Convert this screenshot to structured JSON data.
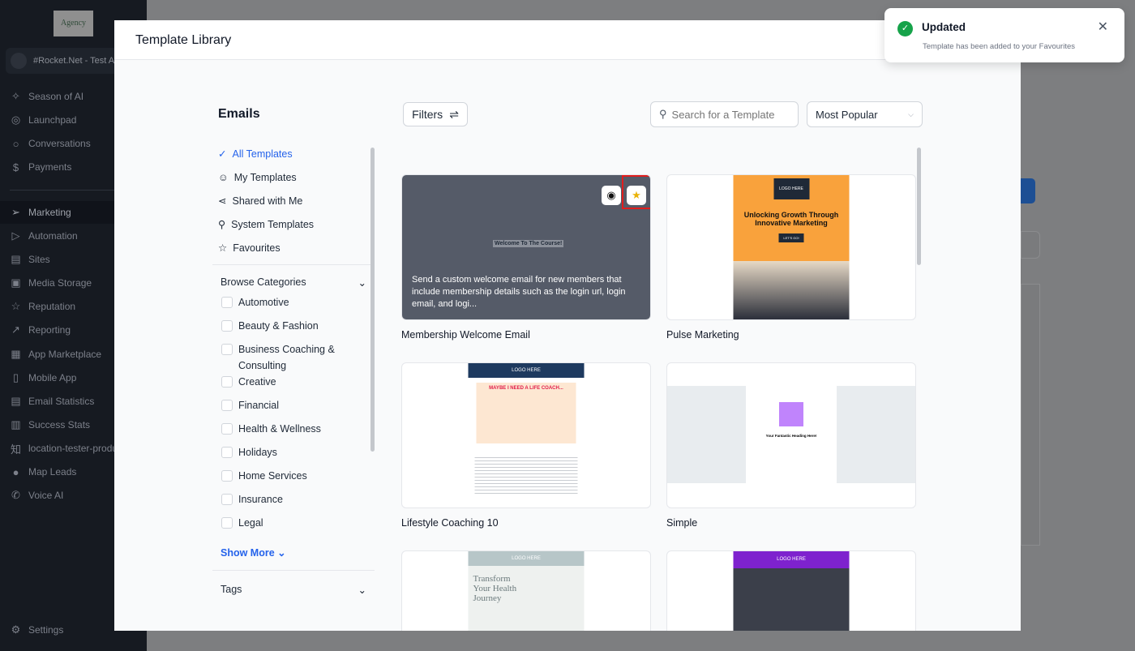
{
  "sidebar": {
    "logo": "Agency",
    "account": "#Rocket.Net - Test A...",
    "items": [
      {
        "label": "Season of AI",
        "icon": "✧"
      },
      {
        "label": "Launchpad",
        "icon": "◎"
      },
      {
        "label": "Conversations",
        "icon": "○"
      },
      {
        "label": "Payments",
        "icon": "$"
      },
      {
        "label": "Marketing",
        "icon": "➢"
      },
      {
        "label": "Automation",
        "icon": "▷"
      },
      {
        "label": "Sites",
        "icon": "▤"
      },
      {
        "label": "Media Storage",
        "icon": "▣"
      },
      {
        "label": "Reputation",
        "icon": "☆"
      },
      {
        "label": "Reporting",
        "icon": "↗"
      },
      {
        "label": "App Marketplace",
        "icon": "▦"
      },
      {
        "label": "Mobile App",
        "icon": "▯"
      },
      {
        "label": "Email Statistics",
        "icon": "▤"
      },
      {
        "label": "Success Stats",
        "icon": "▥"
      },
      {
        "label": "location-tester-produ...",
        "icon": "知"
      },
      {
        "label": "Map Leads",
        "icon": "●"
      },
      {
        "label": "Voice AI",
        "icon": "✆"
      }
    ],
    "settings": "Settings"
  },
  "modal": {
    "title": "Template Library",
    "section": "Emails",
    "filters": "Filters",
    "search_placeholder": "Search for a Template",
    "sort": "Most Popular",
    "nav": [
      {
        "label": "All Templates",
        "icon": "✓"
      },
      {
        "label": "My Templates",
        "icon": "☺"
      },
      {
        "label": "Shared with Me",
        "icon": "⋖"
      },
      {
        "label": "System Templates",
        "icon": "⚲"
      },
      {
        "label": "Favourites",
        "icon": "☆"
      }
    ],
    "browse": "Browse Categories",
    "categories": [
      "Automotive",
      "Beauty & Fashion",
      "Business Coaching & Consulting",
      "Creative",
      "Financial",
      "Health & Wellness",
      "Holidays",
      "Home Services",
      "Insurance",
      "Legal"
    ],
    "show_more": "Show More",
    "tags": "Tags",
    "templates": [
      {
        "name": "Membership Welcome Email",
        "description": "Send a custom welcome email for new members that include membership details such as the login url, login email, and logi...",
        "thumb_heading": "Welcome To The Course!"
      },
      {
        "name": "Pulse Marketing",
        "thumb_logo": "LOGO HERE",
        "thumb_heading": "Unlocking Growth Through Innovative Marketing",
        "thumb_button": "LET'S GO!"
      },
      {
        "name": "Lifestyle Coaching 10",
        "thumb_logo": "LOGO HERE",
        "thumb_heading": "MAYBE I NEED A LIFE COACH..."
      },
      {
        "name": "Simple",
        "thumb_heading": "Your Fantastic Heading Here!"
      },
      {
        "name": "",
        "thumb_logo": "LOGO HERE",
        "thumb_heading": "Transform Your Health Journey"
      },
      {
        "name": "",
        "thumb_logo": "LOGO HERE"
      }
    ]
  },
  "toast": {
    "title": "Updated",
    "message": "Template has been added to your Favourites"
  }
}
